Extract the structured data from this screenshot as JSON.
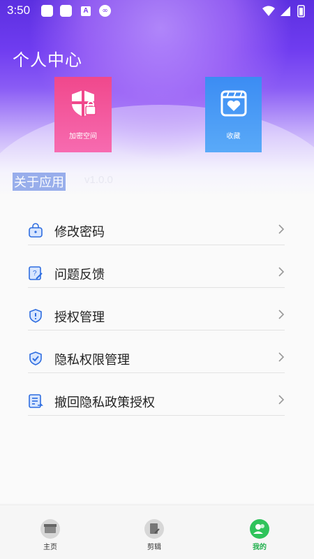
{
  "status_bar": {
    "time": "3:50",
    "icon_c": "A",
    "icon_d": "∞"
  },
  "header": {
    "title": "个人中心",
    "cards": [
      {
        "label": "加密空间",
        "icon": "shield-lock-icon"
      },
      {
        "label": "收藏",
        "icon": "heart-film-icon"
      }
    ],
    "about": "关于应用",
    "version": "v1.0.0"
  },
  "menu": [
    {
      "label": "修改密码",
      "icon": "lock-icon"
    },
    {
      "label": "问题反馈",
      "icon": "feedback-icon"
    },
    {
      "label": "授权管理",
      "icon": "shield-icon"
    },
    {
      "label": "隐私权限管理",
      "icon": "shield-check-icon"
    },
    {
      "label": "撤回隐私政策授权",
      "icon": "document-icon"
    }
  ],
  "tabbar": {
    "items": [
      {
        "label": "主页",
        "icon": "store-icon"
      },
      {
        "label": "剪辑",
        "icon": "edit-doc-icon"
      },
      {
        "label": "我的",
        "icon": "people-icon"
      }
    ],
    "active_color": "#22b04e"
  },
  "colors": {
    "accent": "#6f3cf0",
    "pink": "#f0488c",
    "blue": "#3b8cf3"
  }
}
